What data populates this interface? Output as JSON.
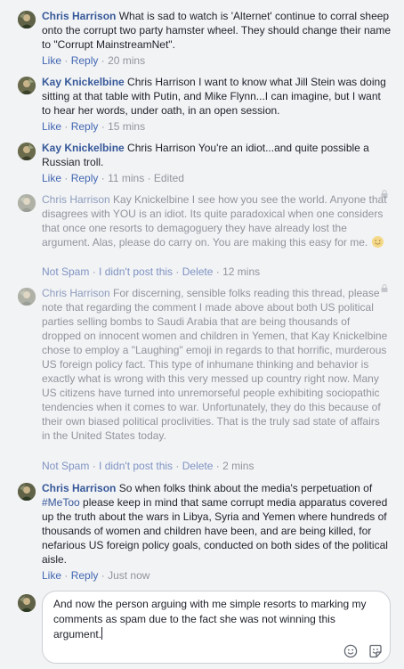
{
  "comments": [
    {
      "name": "Chris Harrison",
      "text": "What is sad to watch is 'Alternet' continue to corral sheep onto the corrupt two party hamster wheel. They should change their name to \"Corrupt MainstreamNet\".",
      "actions": [
        "Like",
        "Reply"
      ],
      "time": "20 mins"
    },
    {
      "name": "Kay Knickelbine",
      "text": "Chris Harrison I want to know what Jill Stein was doing sitting at that table with Putin, and Mike Flynn...I can imagine, but I want to hear her words, under oath, in an open session.",
      "actions": [
        "Like",
        "Reply"
      ],
      "time": "15 mins"
    },
    {
      "name": "Kay Knickelbine",
      "text": "Chris Harrison You're an idiot...and quite possible a Russian troll.",
      "actions": [
        "Like",
        "Reply"
      ],
      "time": "11 mins",
      "edited": "Edited"
    },
    {
      "name": "Chris Harrison",
      "text": "Kay Knickelbine I see how you see the world. Anyone that disagrees with YOU is an idiot. Its quite paradoxical when one considers that once one resorts to demagoguery they have already lost the argument. Alas, please do carry on. You are making this easy for me.",
      "actions": [
        "Not Spam",
        "I didn't post this",
        "Delete"
      ],
      "time": "12 mins",
      "hidden": true
    },
    {
      "name": "Chris Harrison",
      "text": "For discerning, sensible folks reading this thread, please note that regarding the comment I made above about both US political parties selling bombs to Saudi Arabia that are being thousands of dropped on innocent women and children in Yemen, that Kay Knickelbine chose to employ a \"Laughing\" emoji in regards to that horrific, murderous US foreign policy fact. This type of inhumane thinking and behavior is exactly what is wrong with this very messed up country right now. Many US citizens have turned into unremorseful people exhibiting sociopathic tendencies when it comes to war. Unfortunately, they do this because of their own biased political proclivities. That is the truly sad state of affairs in the United States today.",
      "actions": [
        "Not Spam",
        "I didn't post this",
        "Delete"
      ],
      "time": "2 mins",
      "hidden": true
    },
    {
      "name": "Chris Harrison",
      "text_before": "So when folks think about the media's perpetuation of",
      "hashtag": "#MeToo",
      "text_after": "please keep in mind that same corrupt media apparatus covered up the truth about the wars in Libya, Syria and Yemen where hundreds of thousands of women and children have been, and are being killed, for nefarious US foreign policy goals, conducted on both sides of the political aisle.",
      "actions": [
        "Like",
        "Reply"
      ],
      "time": "Just now"
    }
  ],
  "compose": {
    "value": "And now the person arguing with me simple resorts to marking my comments as spam due to the fact she was not winning this argument.",
    "icons": [
      "emoji-icon",
      "sticker-icon"
    ]
  },
  "colors": {
    "background": "#f2f3f5",
    "name_link": "#365899",
    "action_link": "#4267b2",
    "muted_text": "#90949c"
  }
}
